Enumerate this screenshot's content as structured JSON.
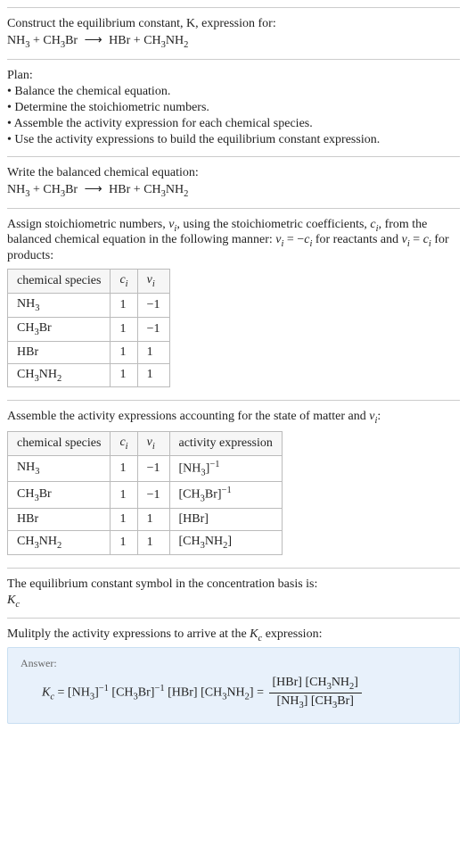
{
  "chart_data": [
    {
      "type": "table",
      "title": "Stoichiometric numbers",
      "columns": [
        "chemical species",
        "c_i",
        "ν_i"
      ],
      "rows": [
        [
          "NH3",
          1,
          -1
        ],
        [
          "CH3Br",
          1,
          -1
        ],
        [
          "HBr",
          1,
          1
        ],
        [
          "CH3NH2",
          1,
          1
        ]
      ]
    },
    {
      "type": "table",
      "title": "Activity expressions",
      "columns": [
        "chemical species",
        "c_i",
        "ν_i",
        "activity expression"
      ],
      "rows": [
        [
          "NH3",
          1,
          -1,
          "[NH3]^-1"
        ],
        [
          "CH3Br",
          1,
          -1,
          "[CH3Br]^-1"
        ],
        [
          "HBr",
          1,
          1,
          "[HBr]"
        ],
        [
          "CH3NH2",
          1,
          1,
          "[CH3NH2]"
        ]
      ]
    }
  ],
  "s1": {
    "title": "Construct the equilibrium constant, K, expression for:",
    "eq_lhs1": "NH",
    "eq_lhs1_sub": "3",
    "plus1": " + ",
    "eq_lhs2a": "CH",
    "eq_lhs2a_sub": "3",
    "eq_lhs2b": "Br",
    "arrow": "⟶",
    "eq_rhs1": "HBr",
    "plus2": " + ",
    "eq_rhs2a": "CH",
    "eq_rhs2a_sub": "3",
    "eq_rhs2b": "NH",
    "eq_rhs2b_sub": "2"
  },
  "s2": {
    "title": "Plan:",
    "b1": "• Balance the chemical equation.",
    "b2": "• Determine the stoichiometric numbers.",
    "b3": "• Assemble the activity expression for each chemical species.",
    "b4": "• Use the activity expressions to build the equilibrium constant expression."
  },
  "s3": {
    "title": "Write the balanced chemical equation:"
  },
  "s4": {
    "t1": "Assign stoichiometric numbers, ",
    "t2": ", using the stoichiometric coefficients, ",
    "t3": ", from the balanced chemical equation in the following manner: ",
    "t4": " for reactants and ",
    "t5": " for products:",
    "nu_i": "ν",
    "nu_i_sub": "i",
    "c_i": "c",
    "c_i_sub": "i",
    "rel1a": "ν",
    "rel1b": " = −",
    "rel1c": "c",
    "rel2a": "ν",
    "rel2b": " = ",
    "rel2c": "c",
    "h1": "chemical species",
    "h2": "c",
    "h2sub": "i",
    "h3": "ν",
    "h3sub": "i",
    "r1c1": "NH",
    "r1c1sub": "3",
    "r1c2": "1",
    "r1c3": "−1",
    "r2c1a": "CH",
    "r2c1asub": "3",
    "r2c1b": "Br",
    "r2c2": "1",
    "r2c3": "−1",
    "r3c1": "HBr",
    "r3c2": "1",
    "r3c3": "1",
    "r4c1a": "CH",
    "r4c1asub": "3",
    "r4c1b": "NH",
    "r4c1bsub": "2",
    "r4c2": "1",
    "r4c3": "1"
  },
  "s5": {
    "title": "Assemble the activity expressions accounting for the state of matter and ",
    "nu": "ν",
    "nusub": "i",
    "colon": ":",
    "h1": "chemical species",
    "h2": "c",
    "h2sub": "i",
    "h3": "ν",
    "h3sub": "i",
    "h4": "activity expression",
    "r1c1": "NH",
    "r1c1sub": "3",
    "r1c2": "1",
    "r1c3": "−1",
    "r1c4a": "[NH",
    "r1c4asub": "3",
    "r1c4b": "]",
    "r1c4sup": "−1",
    "r2c1a": "CH",
    "r2c1asub": "3",
    "r2c1b": "Br",
    "r2c2": "1",
    "r2c3": "−1",
    "r2c4a": "[CH",
    "r2c4asub": "3",
    "r2c4b": "Br]",
    "r2c4sup": "−1",
    "r3c1": "HBr",
    "r3c2": "1",
    "r3c3": "1",
    "r3c4": "[HBr]",
    "r4c1a": "CH",
    "r4c1asub": "3",
    "r4c1b": "NH",
    "r4c1bsub": "2",
    "r4c2": "1",
    "r4c3": "1",
    "r4c4a": "[CH",
    "r4c4asub": "3",
    "r4c4b": "NH",
    "r4c4bsub": "2",
    "r4c4c": "]"
  },
  "s6": {
    "title": "The equilibrium constant symbol in the concentration basis is:",
    "sym": "K",
    "symsub": "c"
  },
  "s7": {
    "t1": "Mulitply the activity expressions to arrive at the ",
    "k": "K",
    "ksub": "c",
    "t2": " expression:",
    "answer": "Answer:",
    "kc": "K",
    "kcsub": "c",
    "eq": " = ",
    "p1a": "[NH",
    "p1asub": "3",
    "p1b": "]",
    "p1sup": "−1",
    "sp": " ",
    "p2a": "[CH",
    "p2asub": "3",
    "p2b": "Br]",
    "p2sup": "−1",
    "p3": "[HBr]",
    "p4a": "[CH",
    "p4asub": "3",
    "p4b": "NH",
    "p4bsub": "2",
    "p4c": "]",
    "eq2": " = ",
    "num1": "[HBr] ",
    "num2a": "[CH",
    "num2asub": "3",
    "num2b": "NH",
    "num2bsub": "2",
    "num2c": "]",
    "den1a": "[NH",
    "den1asub": "3",
    "den1b": "] ",
    "den2a": "[CH",
    "den2asub": "3",
    "den2b": "Br]"
  }
}
